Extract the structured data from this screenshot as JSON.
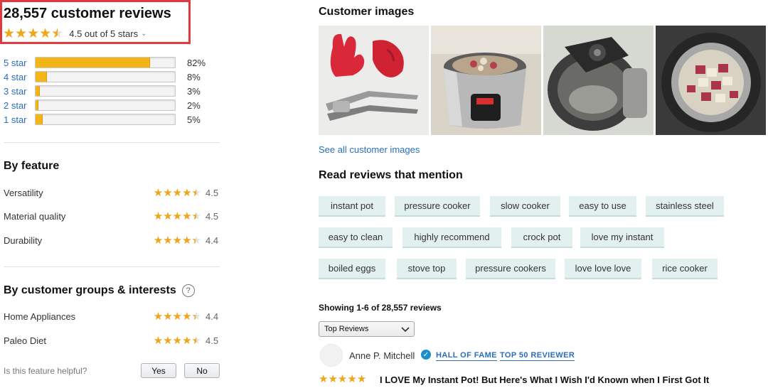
{
  "summary": {
    "total_reviews": "28,557 customer reviews",
    "average_text": "4.5 out of 5 stars",
    "average_rating": 4.5
  },
  "histogram": [
    {
      "label": "5 star",
      "percent": 82,
      "percent_text": "82%"
    },
    {
      "label": "4 star",
      "percent": 8,
      "percent_text": "8%"
    },
    {
      "label": "3 star",
      "percent": 3,
      "percent_text": "3%"
    },
    {
      "label": "2 star",
      "percent": 2,
      "percent_text": "2%"
    },
    {
      "label": "1 star",
      "percent": 5,
      "percent_text": "5%"
    }
  ],
  "by_feature": {
    "title": "By feature",
    "items": [
      {
        "name": "Versatility",
        "rating": 4.5,
        "rating_text": "4.5"
      },
      {
        "name": "Material quality",
        "rating": 4.5,
        "rating_text": "4.5"
      },
      {
        "name": "Durability",
        "rating": 4.4,
        "rating_text": "4.4"
      }
    ]
  },
  "by_groups": {
    "title": "By customer groups & interests",
    "help_icon": "question-circle-icon",
    "items": [
      {
        "name": "Home Appliances",
        "rating": 4.4,
        "rating_text": "4.4"
      },
      {
        "name": "Paleo Diet",
        "rating": 4.5,
        "rating_text": "4.5"
      }
    ]
  },
  "helpful": {
    "question": "Is this feature helpful?",
    "yes_label": "Yes",
    "no_label": "No"
  },
  "customer_images": {
    "title": "Customer images",
    "see_all": "See all customer images"
  },
  "mentions": {
    "title": "Read reviews that mention",
    "rows": [
      [
        "instant pot",
        "pressure cooker",
        "slow cooker",
        "easy to use",
        "stainless steel"
      ],
      [
        "easy to clean",
        "highly recommend",
        "crock pot",
        "love my instant"
      ],
      [
        "boiled eggs",
        "stove top",
        "pressure cookers",
        "love love love",
        "rice cooker"
      ]
    ]
  },
  "reviews": {
    "showing": "Showing 1-6 of 28,557 reviews",
    "sort_selected": "Top Reviews",
    "first_review": {
      "reviewer": "Anne P. Mitchell",
      "badges": [
        "HALL OF FAME",
        "TOP 50 REVIEWER"
      ],
      "rating": 5,
      "title": "I LOVE My Instant Pot! But Here's What I Wish I'd Known when I First Got It"
    }
  },
  "colors": {
    "star": "#f0a619",
    "bar": "#f3b616",
    "link": "#2a6ebb",
    "highlight_border": "#e03a3e",
    "chip_bg": "#e3f0f0"
  }
}
